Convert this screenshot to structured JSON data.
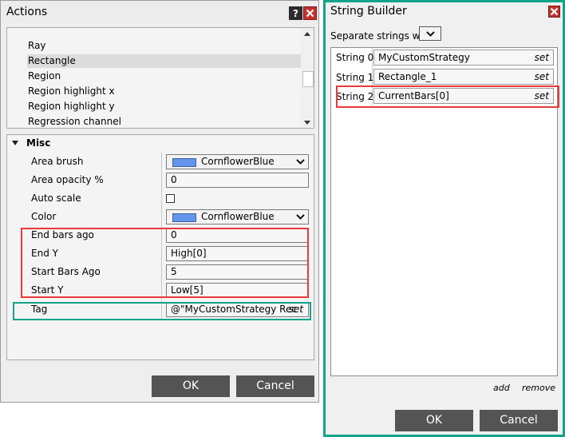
{
  "actions": {
    "title": "Actions",
    "help_label": "?",
    "list_items": [
      "Ray",
      "Rectangle",
      "Region",
      "Region highlight x",
      "Region highlight y",
      "Regression channel"
    ],
    "selected_item": "Rectangle",
    "category": "Misc",
    "properties": [
      {
        "name": "Area brush",
        "type": "color",
        "value": "CornflowerBlue"
      },
      {
        "name": "Area opacity %",
        "type": "text",
        "value": "0"
      },
      {
        "name": "Auto scale",
        "type": "checkbox",
        "value": "unchecked"
      },
      {
        "name": "Color",
        "type": "color",
        "value": "CornflowerBlue"
      },
      {
        "name": "End bars ago",
        "type": "text",
        "value": "0"
      },
      {
        "name": "End Y",
        "type": "text",
        "value": "High[0]"
      },
      {
        "name": "Start Bars Ago",
        "type": "text",
        "value": "5"
      },
      {
        "name": "Start Y",
        "type": "text",
        "value": "Low[5]"
      },
      {
        "name": "Tag",
        "type": "string-builder",
        "value": "@\"MyCustomStrategy Rec",
        "set_label": "set"
      }
    ],
    "ok_label": "OK",
    "cancel_label": "Cancel"
  },
  "string_builder": {
    "title": "String Builder",
    "separator_label": "Separate strings with",
    "separator_value": "",
    "rows": [
      {
        "label": "String 0",
        "value": "MyCustomStrategy",
        "set_label": "set"
      },
      {
        "label": "String 1",
        "value": "Rectangle_1",
        "set_label": "set"
      },
      {
        "label": "String 2",
        "value": "CurrentBars[0]",
        "set_label": "set"
      }
    ],
    "add_label": "add",
    "remove_label": "remove",
    "ok_label": "OK",
    "cancel_label": "Cancel"
  },
  "colors": {
    "cornflower_blue": "#6495ED",
    "highlight_red": "#e8393a",
    "highlight_green": "#12a38a",
    "button_gray": "#545454"
  },
  "icons": [
    "help-icon",
    "close-icon",
    "chevron-down-icon",
    "collapse-triangle-icon",
    "scroll-up-icon",
    "scroll-down-icon"
  ]
}
